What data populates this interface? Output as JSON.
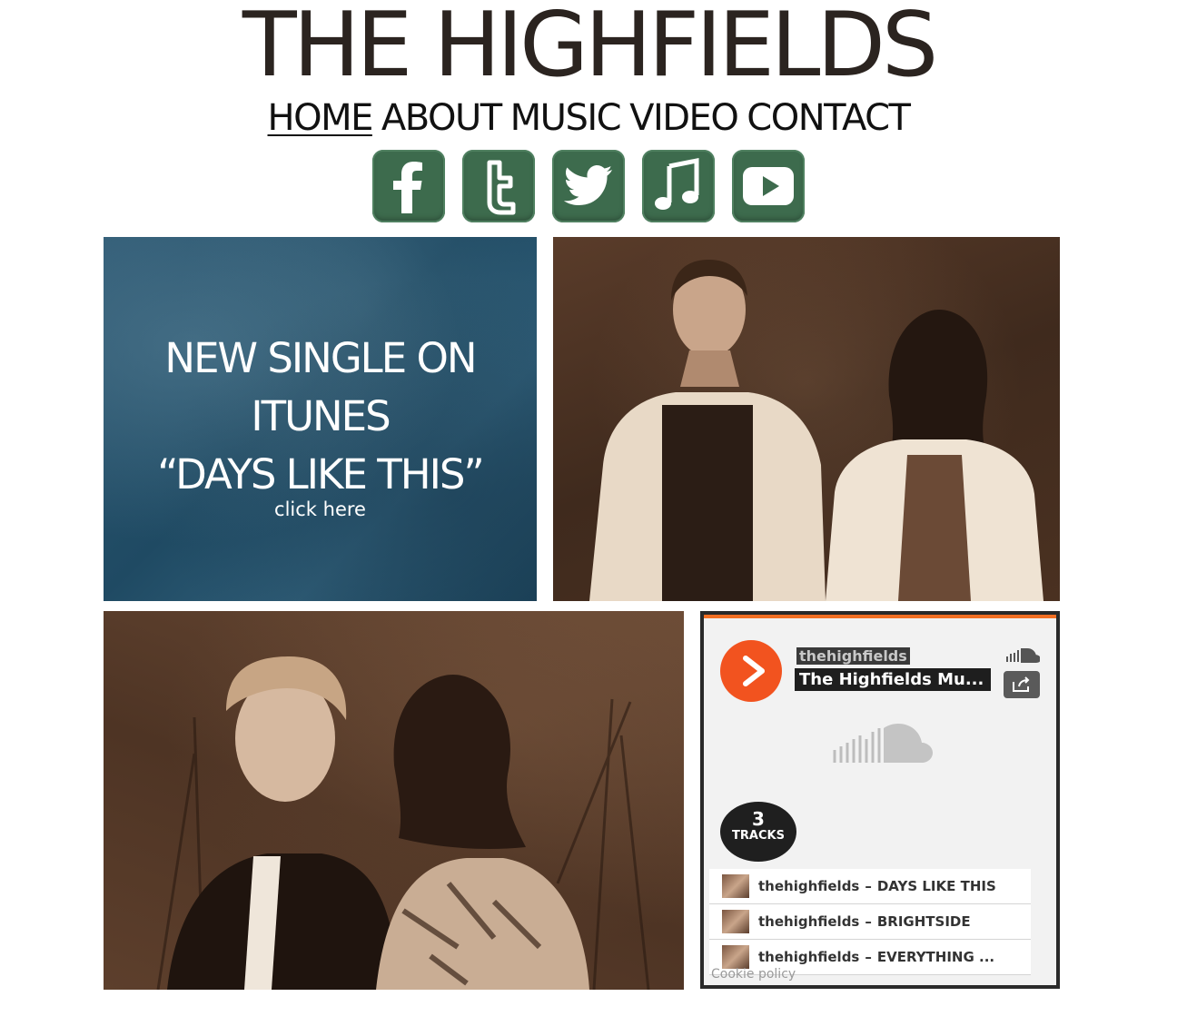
{
  "site": {
    "title": "THE HIGHFIELDS"
  },
  "nav": {
    "items": [
      "HOME",
      "ABOUT",
      "MUSIC",
      "VIDEO",
      "CONTACT"
    ],
    "active": "HOME"
  },
  "social": {
    "color": "#3d6b4d",
    "icons": [
      "facebook-icon",
      "tumblr-icon",
      "twitter-icon",
      "music-note-icon",
      "youtube-icon"
    ]
  },
  "promo": {
    "line1": "NEW SINGLE ON",
    "line2": "ITUNES",
    "line3": "“DAYS LIKE THIS”",
    "cta": "click here",
    "background": "#2d5872"
  },
  "player": {
    "accent": "#f26f23",
    "uploader": "thehighfields",
    "set_title": "The Highfields Mu...",
    "track_count": "3",
    "track_count_label": "TRACKS",
    "tracks": [
      {
        "artist": "thehighfields",
        "sep": "–",
        "title": "DAYS LIKE THIS"
      },
      {
        "artist": "thehighfields",
        "sep": "–",
        "title": "BRIGHTSIDE"
      },
      {
        "artist": "thehighfields",
        "sep": "–",
        "title": "EVERYTHING ..."
      }
    ],
    "cookie": "Cookie policy"
  }
}
